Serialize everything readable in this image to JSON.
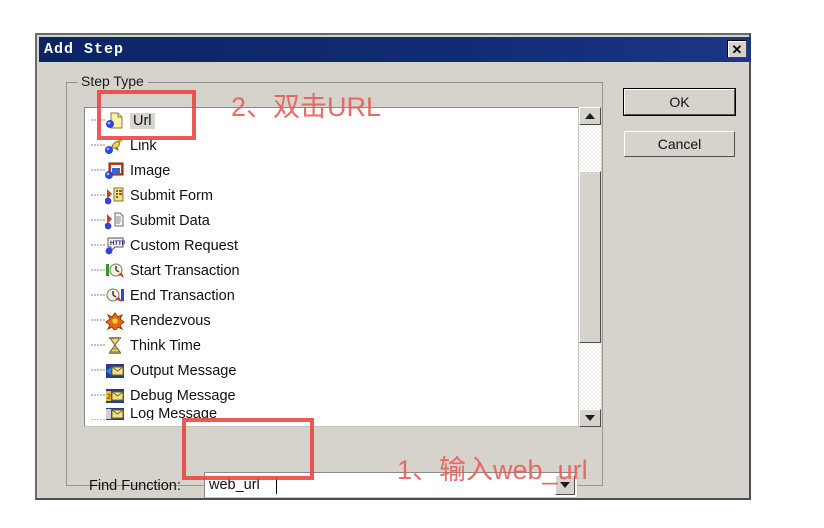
{
  "window": {
    "title": "Add Step",
    "close_label": "✕",
    "close_icon": "close-icon"
  },
  "group": {
    "label": "Step Type"
  },
  "list": {
    "selected": "Url",
    "items": [
      {
        "label": "Url",
        "icon": "url-page-icon",
        "selected": true,
        "clipped": false
      },
      {
        "label": "Link",
        "icon": "link-chain-icon",
        "selected": false,
        "clipped": false
      },
      {
        "label": "Image",
        "icon": "image-picture-icon",
        "selected": false,
        "clipped": false
      },
      {
        "label": "Submit Form",
        "icon": "submit-form-icon",
        "selected": false,
        "clipped": false
      },
      {
        "label": "Submit Data",
        "icon": "submit-data-icon",
        "selected": false,
        "clipped": false
      },
      {
        "label": "Custom Request",
        "icon": "http-custom-request-icon",
        "selected": false,
        "clipped": false
      },
      {
        "label": "Start Transaction",
        "icon": "start-transaction-icon",
        "selected": false,
        "clipped": false
      },
      {
        "label": "End Transaction",
        "icon": "end-transaction-icon",
        "selected": false,
        "clipped": false
      },
      {
        "label": "Rendezvous",
        "icon": "rendezvous-icon",
        "selected": false,
        "clipped": false
      },
      {
        "label": "Think Time",
        "icon": "hourglass-icon",
        "selected": false,
        "clipped": false
      },
      {
        "label": "Output Message",
        "icon": "output-message-icon",
        "selected": false,
        "clipped": false
      },
      {
        "label": "Debug Message",
        "icon": "debug-message-icon",
        "selected": false,
        "clipped": false
      },
      {
        "label": "Log Message",
        "icon": "log-message-icon",
        "selected": false,
        "clipped": true
      }
    ]
  },
  "scrollbar": {
    "up_icon": "scroll-up-arrow-icon",
    "down_icon": "scroll-down-arrow-icon",
    "thumb_icon": "scroll-thumb"
  },
  "find": {
    "label": "Find Function:",
    "value": "web_url",
    "placeholder": "",
    "dropdown_icon": "chevron-down-icon"
  },
  "buttons": {
    "ok": "OK",
    "cancel": "Cancel"
  },
  "annotations": {
    "step1": "1、输入web_url",
    "step2": "2、双击URL",
    "highlight_color": "#e8433f",
    "text_color": "#e8605c"
  }
}
